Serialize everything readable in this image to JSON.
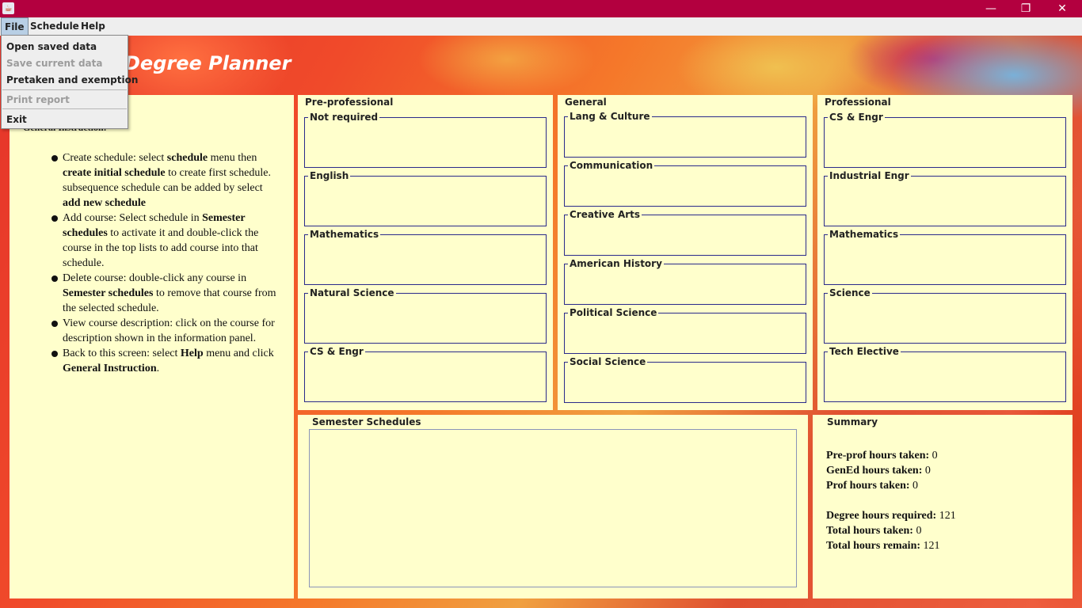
{
  "window": {
    "controls": {
      "minimize": "—",
      "maximize": "❐",
      "close": "✕"
    }
  },
  "menubar": {
    "items": [
      {
        "label": "File",
        "active": true
      },
      {
        "label": "Schedule",
        "active": false
      },
      {
        "label": "Help",
        "active": false
      }
    ]
  },
  "file_menu": {
    "items": [
      {
        "label": "Open saved data",
        "enabled": true
      },
      {
        "label": "Save current data",
        "enabled": false
      },
      {
        "label": "Pretaken and exemption",
        "enabled": true
      },
      {
        "label": "Print report",
        "enabled": false
      },
      {
        "label": "Exit",
        "enabled": true
      }
    ]
  },
  "header": {
    "app_title": "Degree Planner"
  },
  "instructions": {
    "heading": "General Instruction:",
    "items": [
      "Create schedule: select <b>schedule</b> menu then <b>create initial schedule</b> to create first schedule. subsequence schedule can be added by select <b>add new schedule</b>",
      "Add course: Select schedule in <b>Semester schedules</b> to activate it and double-click the course in the top lists to add course into that schedule.",
      "Delete course: double-click any course in <b>Semester schedules</b> to remove that course from the selected schedule.",
      "View course description: click on the course for description shown in the information panel.",
      "Back to this screen: select <b>Help</b> menu and click <b>General Instruction</b>."
    ]
  },
  "pre_professional": {
    "title": "Pre-professional",
    "groups": [
      "Not required",
      "English",
      "Mathematics",
      "Natural Science",
      "CS & Engr"
    ]
  },
  "general": {
    "title": "General",
    "groups": [
      "Lang & Culture",
      "Communication",
      "Creative Arts",
      "American History",
      "Political Science",
      "Social Science"
    ]
  },
  "professional": {
    "title": "Professional",
    "groups": [
      "CS & Engr",
      "Industrial Engr",
      "Mathematics",
      "Science",
      "Tech Elective"
    ]
  },
  "semester": {
    "title": "Semester Schedules"
  },
  "summary": {
    "title": "Summary",
    "rows": [
      {
        "label": "Pre-prof hours taken:",
        "value": "0"
      },
      {
        "label": "GenEd hours taken:",
        "value": "0"
      },
      {
        "label": "Prof hours taken:",
        "value": "0"
      },
      {
        "label": "",
        "value": ""
      },
      {
        "label": "Degree hours required:",
        "value": "121"
      },
      {
        "label": "Total hours taken:",
        "value": "0"
      },
      {
        "label": "Total hours remain:",
        "value": "121"
      }
    ]
  }
}
